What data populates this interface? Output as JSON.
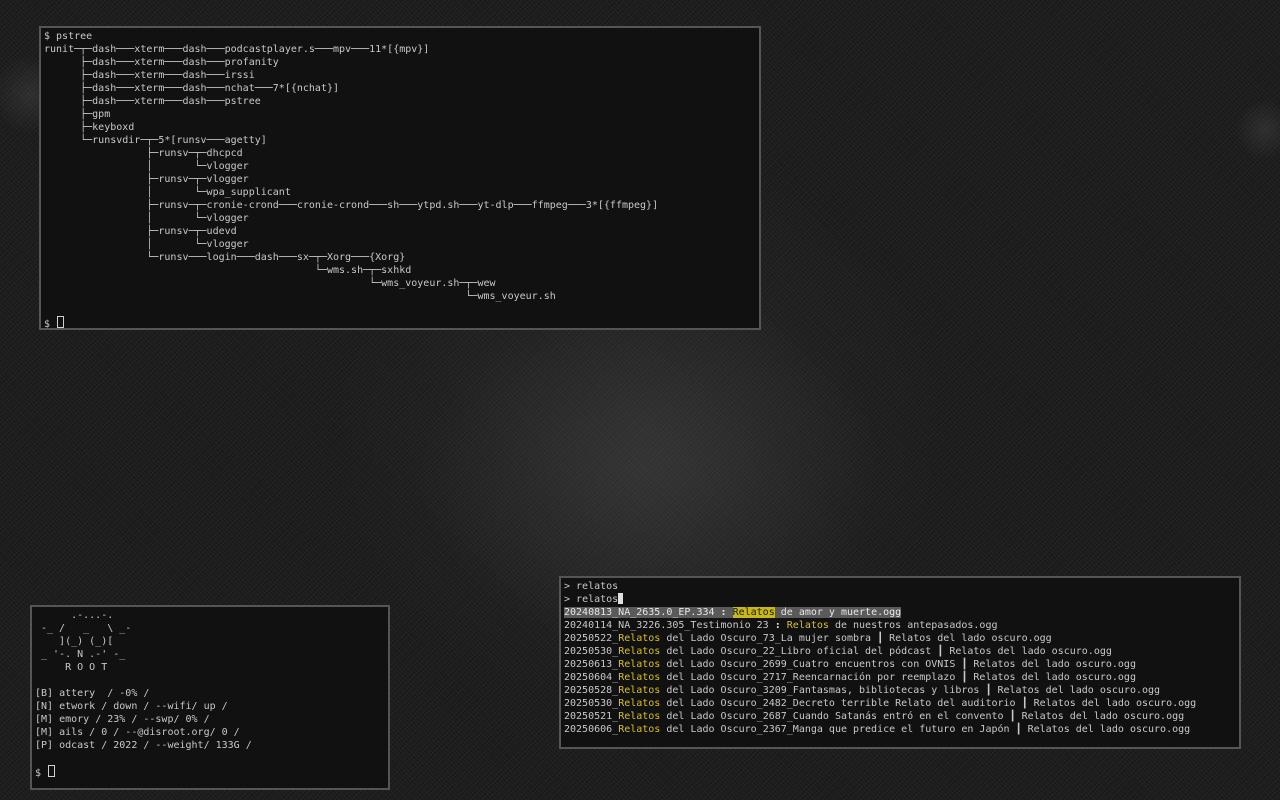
{
  "pstree_terminal": {
    "command_line": "$ pstree",
    "tree_lines": [
      "runit─┬─dash───xterm───dash───podcastplayer.s───mpv───11*[{mpv}]",
      "      ├─dash───xterm───dash───profanity",
      "      ├─dash───xterm───dash───irssi",
      "      ├─dash───xterm───dash───nchat───7*[{nchat}]",
      "      ├─dash───xterm───dash───pstree",
      "      ├─gpm",
      "      ├─keyboxd",
      "      └─runsvdir─┬─5*[runsv───agetty]",
      "                 ├─runsv─┬─dhcpcd",
      "                 │       └─vlogger",
      "                 ├─runsv─┬─vlogger",
      "                 │       └─wpa_supplicant",
      "                 ├─runsv─┬─cronie-crond───cronie-crond───sh───ytpd.sh───yt-dlp───ffmpeg───3*[{ffmpeg}]",
      "                 │       └─vlogger",
      "                 ├─runsv─┬─udevd",
      "                 │       └─vlogger",
      "                 └─runsv───login───dash───sx─┬─Xorg───{Xorg}",
      "                                             └─wms.sh─┬─sxhkd",
      "                                                      └─wms_voyeur.sh─┬─wew",
      "                                                                      └─wms_voyeur.sh"
    ],
    "prompt": "$ "
  },
  "status_terminal": {
    "logo_lines": [
      "     .-...-.",
      "-_ /   _   \\ _-",
      "   ](_) (_)[",
      "_ '-. N .-' -_",
      "    R O O T"
    ],
    "status_lines": [
      "[B] attery  / -0% /",
      "[N] etwork / down / --wifi/ up /",
      "[M] emory / 23% / --swp/ 0% /",
      "[M] ails / 0 / --@disroot.org/ 0 /",
      "[P] odcast / 2022 / --weight/ 133G /"
    ],
    "prompt": "$ "
  },
  "fzf_terminal": {
    "history_line": "> relatos",
    "query_prefix": "> ",
    "query": "relatos",
    "results": [
      {
        "pre": "20240813_NA_2635.0_EP.334",
        "sep": " : ",
        "match": "Relatos",
        "post": " de amor y muerte.ogg",
        "selected": true
      },
      {
        "pre": "20240114_NA_3226.305_Testimonio 23",
        "sep": " : ",
        "match": "Relatos",
        "post": " de nuestros antepasados.ogg",
        "selected": false
      },
      {
        "pre": "20250522_",
        "sep": "",
        "match": "Relatos",
        "post": " del Lado Oscuro_73_La mujer sombra ┃ Relatos del lado oscuro.ogg",
        "selected": false
      },
      {
        "pre": "20250530_",
        "sep": "",
        "match": "Relatos",
        "post": " del Lado Oscuro_22_Libro oficial del pódcast ┃ Relatos del lado oscuro.ogg",
        "selected": false
      },
      {
        "pre": "20250613_",
        "sep": "",
        "match": "Relatos",
        "post": " del Lado Oscuro_2699_Cuatro encuentros con OVNIS ┃ Relatos del lado oscuro.ogg",
        "selected": false
      },
      {
        "pre": "20250604_",
        "sep": "",
        "match": "Relatos",
        "post": " del Lado Oscuro_2717_Reencarnación por reemplazo ┃ Relatos del lado oscuro.ogg",
        "selected": false
      },
      {
        "pre": "20250528_",
        "sep": "",
        "match": "Relatos",
        "post": " del Lado Oscuro_3209_Fantasmas, bibliotecas y libros ┃ Relatos del lado oscuro.ogg",
        "selected": false
      },
      {
        "pre": "20250530_",
        "sep": "",
        "match": "Relatos",
        "post": " del Lado Oscuro_2482_Decreto terrible Relato del auditorio ┃ Relatos del lado oscuro.ogg",
        "selected": false
      },
      {
        "pre": "20250521_",
        "sep": "",
        "match": "Relatos",
        "post": " del Lado Oscuro_2687_Cuando Satanás entró en el convento ┃ Relatos del lado oscuro.ogg",
        "selected": false
      },
      {
        "pre": "20250606_",
        "sep": "",
        "match": "Relatos",
        "post": " del Lado Oscuro_2367_Manga que predice el futuro en Japón ┃ Relatos del lado oscuro.ogg",
        "selected": false
      }
    ]
  },
  "colors": {
    "terminal_bg": "#111111",
    "border": "#555555",
    "text": "#c8c8c8",
    "match_highlight": "#d8c020",
    "selection_bg": "#5a5a5a"
  }
}
